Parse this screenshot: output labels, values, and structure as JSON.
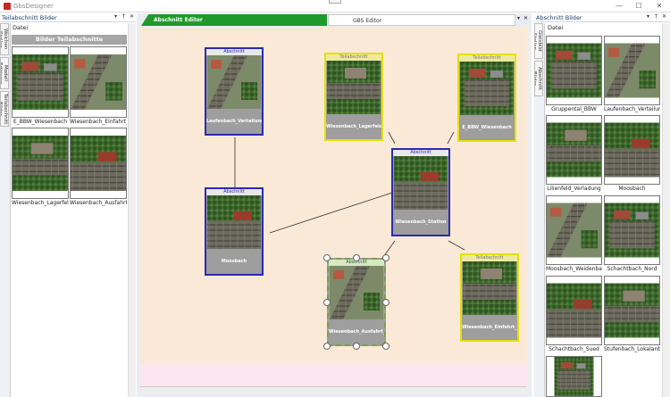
{
  "window": {
    "title": "GbsDesigner",
    "minimize": "—",
    "maximize": "☐",
    "close": "✕"
  },
  "left_panel": {
    "title": "Teilabschnitt Bilder",
    "menu": "Datei",
    "header": "Bilder Teilabschnitte",
    "vtabs": [
      "Weichen Stellen",
      "Modell Editieren",
      "Teilabschnitt Bilder"
    ],
    "items": [
      {
        "label": "E_BBW_Wiesenbach"
      },
      {
        "label": "Wiesenbach_Einfahrt_Ost"
      },
      {
        "label": "Wiesenbach_Lagerfeld"
      },
      {
        "label": "Wiesenbach_Ausfahrt_West"
      }
    ]
  },
  "tabs": {
    "editor": "Abschnitt Editor",
    "gbs": "GBS Editor"
  },
  "cards": [
    {
      "caption": "Abschnitt",
      "name": "Laufenbach_Verteilung"
    },
    {
      "caption": "Teilabschnitt",
      "name": "Wiesenbach_Lagerfeld"
    },
    {
      "caption": "Teilabschnitt",
      "name": "E_BBW_Wiesenbach"
    },
    {
      "caption": "Abschnitt",
      "name": "Wiesenbach_Station"
    },
    {
      "caption": "Abschnitt",
      "name": "Moosbach"
    },
    {
      "caption": "Abschnitt",
      "name": "Wiesenbach_Ausfahrt_West"
    },
    {
      "caption": "Teilabschnitt",
      "name": "Wiesenbach_Einfahrt_Ost"
    }
  ],
  "right_panel": {
    "title": "Abschnitt Bilder",
    "menu": "Datei",
    "vtabs": [
      "Gleisbild Stellen",
      "Abschnitt Bilder"
    ],
    "items": [
      {
        "label": "Gruppental_BBW"
      },
      {
        "label": "Laufenbach_Verteilung"
      },
      {
        "label": "Lilienfeld_Verladung"
      },
      {
        "label": "Moosbach"
      },
      {
        "label": "Moosbach_Weidenbach"
      },
      {
        "label": "Schachtbach_Nord"
      },
      {
        "label": "Schachtbach_Sued"
      },
      {
        "label": "Stufenbach_Lokalanbindung"
      }
    ]
  },
  "panel_icons": {
    "dropdown": "▾",
    "pin": "†",
    "close": "✕"
  }
}
